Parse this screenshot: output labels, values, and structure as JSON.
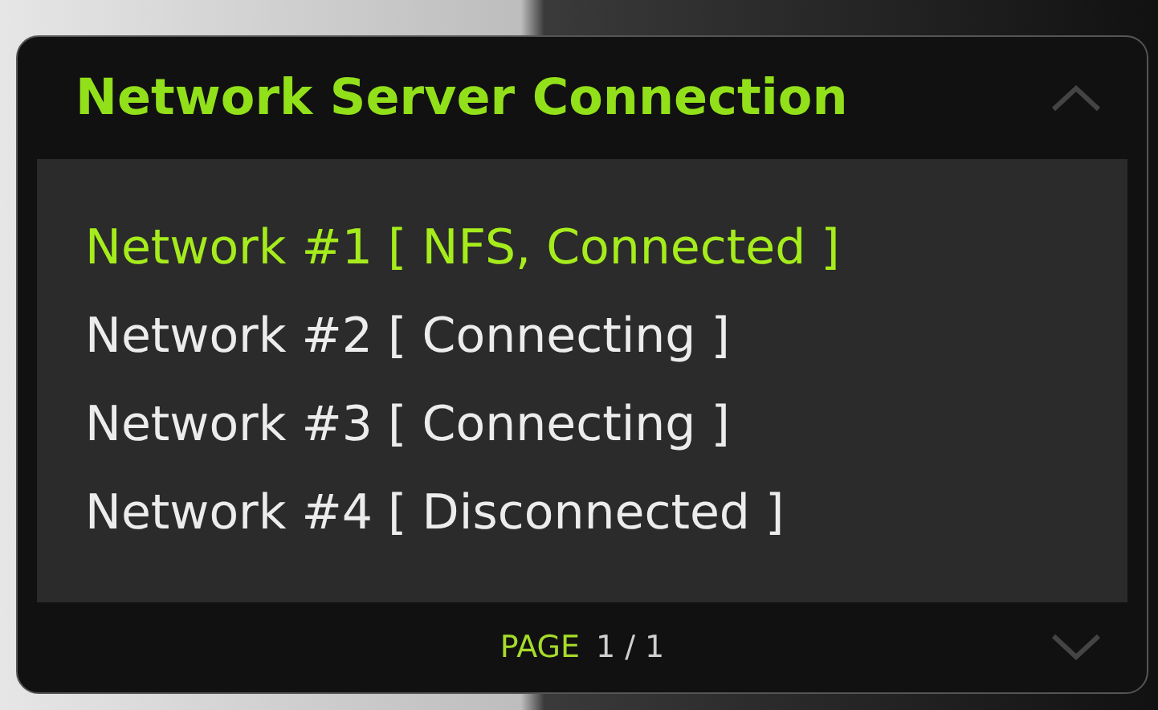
{
  "dialog": {
    "title": "Network Server Connection"
  },
  "networks": [
    {
      "label": "Network #1 [ NFS, Connected ]",
      "selected": true
    },
    {
      "label": "Network #2 [ Connecting ]",
      "selected": false
    },
    {
      "label": "Network #3 [ Connecting ]",
      "selected": false
    },
    {
      "label": "Network #4 [ Disconnected ]",
      "selected": false
    }
  ],
  "footer": {
    "page_label": "PAGE",
    "page_value": "1 / 1"
  }
}
